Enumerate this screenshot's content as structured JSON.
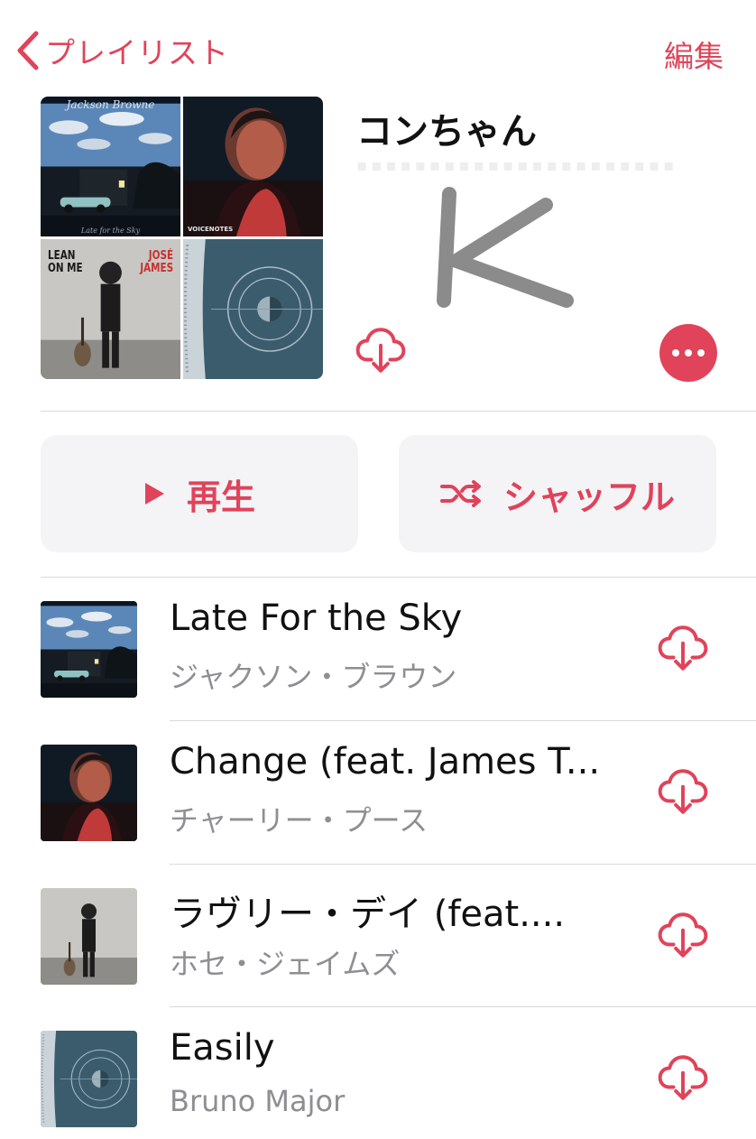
{
  "nav": {
    "back_label": "プレイリスト",
    "edit_label": "編集"
  },
  "playlist": {
    "title": "コンちゃん",
    "description_mark": "K"
  },
  "artwork_tiles": [
    {
      "artist": "Jackson Browne",
      "album": "Late for the Sky"
    },
    {
      "album": "VOICENOTES"
    },
    {
      "title_lines": [
        "LEAN",
        "ON ME"
      ],
      "artist_lines": [
        "JOSÉ",
        "JAMES"
      ]
    },
    {
      "album": ""
    }
  ],
  "actions": {
    "play_label": "再生",
    "shuffle_label": "シャッフル"
  },
  "tracks": [
    {
      "title": "Late For the Sky",
      "artist": "ジャクソン・ブラウン"
    },
    {
      "title": "Change (feat. James T...",
      "artist": "チャーリー・プース"
    },
    {
      "title": "ラヴリー・デイ (feat....",
      "artist": "ホセ・ジェイムズ"
    },
    {
      "title": "Easily",
      "artist": "Bruno Major"
    }
  ],
  "colors": {
    "accent": "#e0435a",
    "secondary_text": "#8e8e93",
    "button_bg": "#f4f4f7"
  },
  "icons": [
    "chevron-left-icon",
    "cloud-download-icon",
    "ellipsis-icon",
    "play-icon",
    "shuffle-icon"
  ]
}
